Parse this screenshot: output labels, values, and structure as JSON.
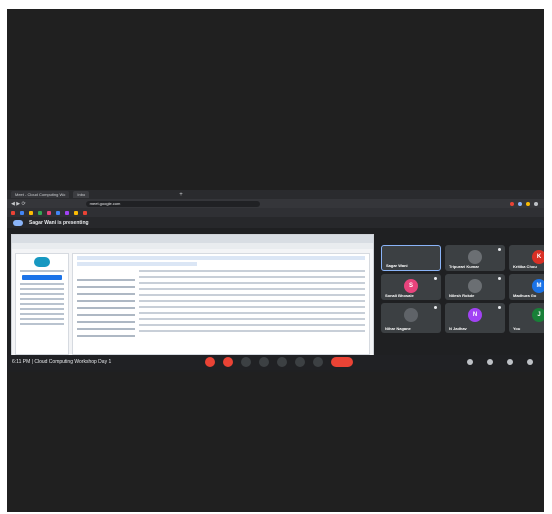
{
  "browser": {
    "tabs": [
      {
        "label": "Meet - Cloud Computing Wo"
      },
      {
        "label": "Inbo"
      }
    ],
    "url": "meet.google.com"
  },
  "banner": {
    "text": "Sagar Wani is presenting"
  },
  "participants": [
    {
      "name": "Sagar Wani",
      "initial": "",
      "color": "#3c4043",
      "selected": true
    },
    {
      "name": "Tripurari Kumar",
      "initial": "",
      "color": "#6b6f73"
    },
    {
      "name": "Kritika Chou",
      "initial": "K",
      "color": "#d93025"
    },
    {
      "name": "Sonali Bhosale",
      "initial": "S",
      "color": "#e8437c"
    },
    {
      "name": "Nilesh Rokde",
      "initial": "",
      "color": "#6b6f73"
    },
    {
      "name": "Madhura Go",
      "initial": "M",
      "color": "#1a73e8"
    },
    {
      "name": "Nihar Nagane",
      "initial": "",
      "color": "#5f6368"
    },
    {
      "name": "N Jadhav",
      "initial": "N",
      "color": "#a142f4"
    },
    {
      "name": "You",
      "initial": "J",
      "color": "#188038"
    }
  ],
  "meeting": {
    "time": "6:11 PM",
    "separator": "|",
    "title": "Cloud Computing Workshop Day 1"
  },
  "colors": {
    "accent": "#8ab4f8",
    "hangup": "#ea4335",
    "panel": "#3c4043"
  }
}
